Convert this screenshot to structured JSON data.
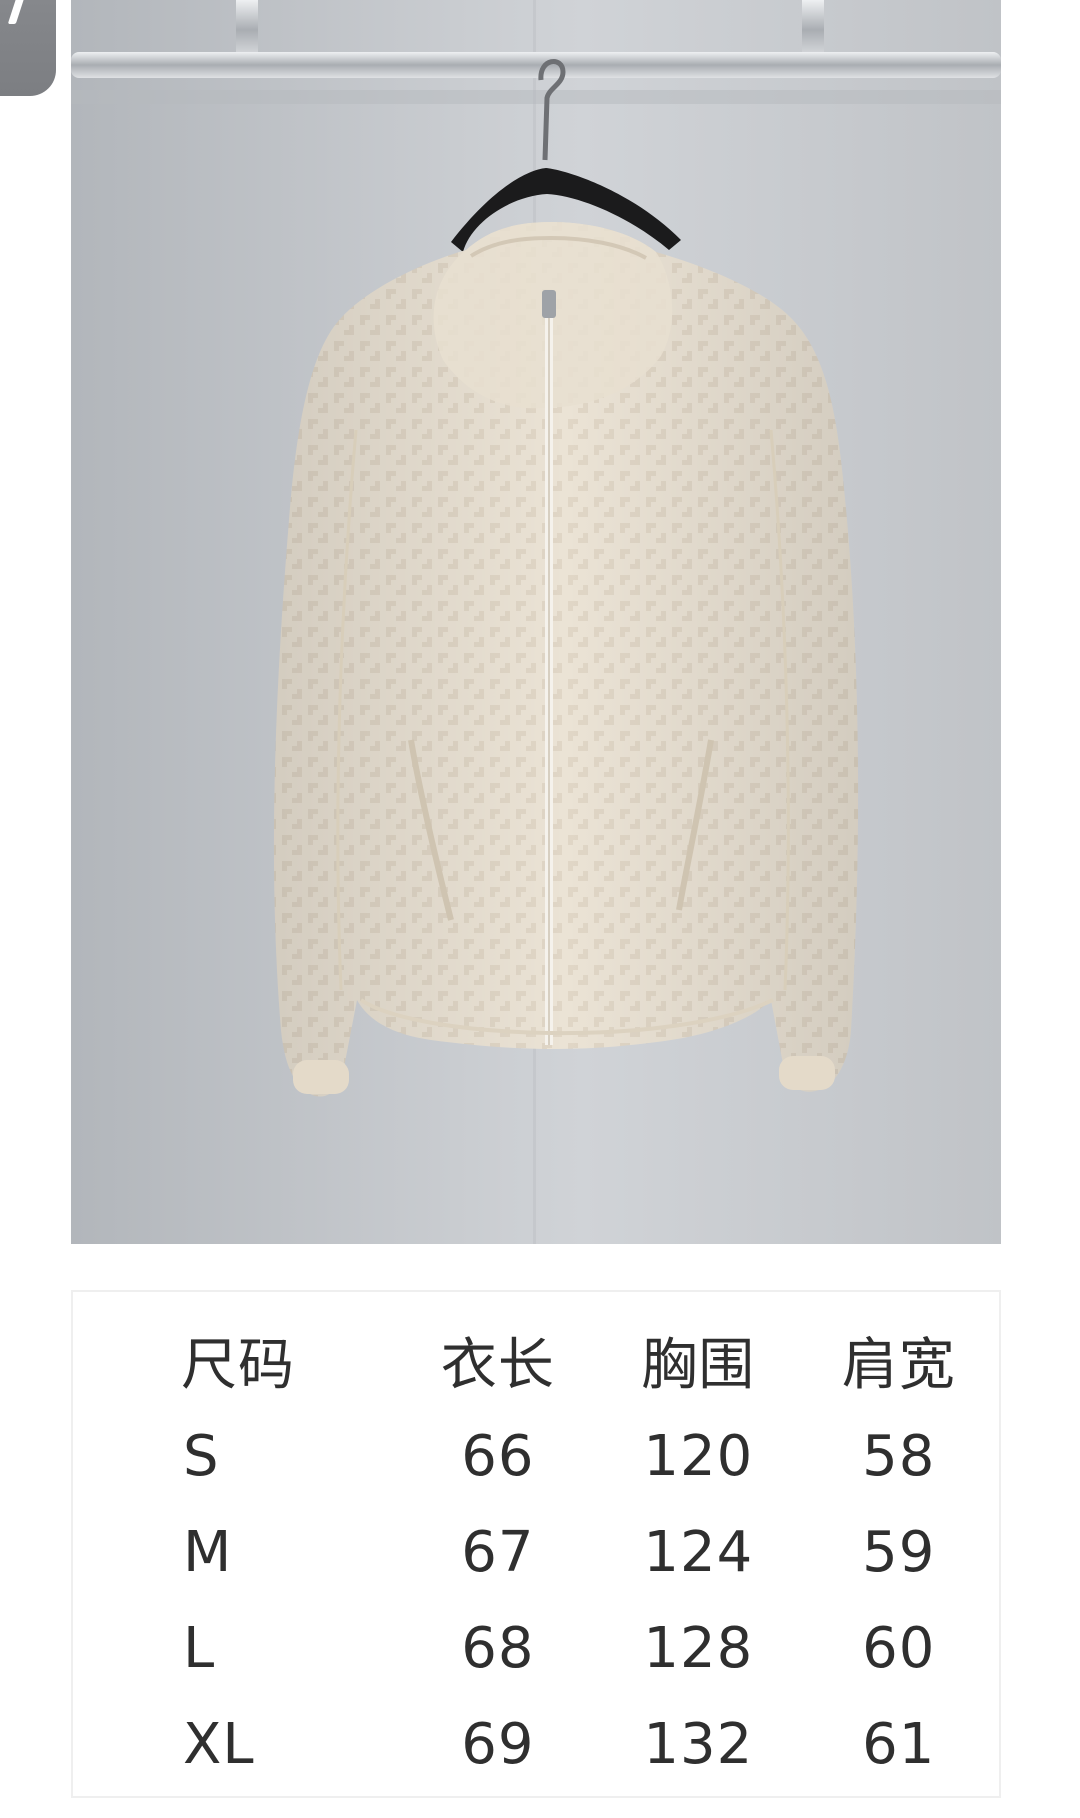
{
  "photo": {
    "subject": "hooded-zip-jacket-on-hanger",
    "jacket_color": "#ebe2d3",
    "wall_color": "#c8cbcf",
    "rail_color": "#b9bcc0",
    "hanger_color": "#1c1c1c"
  },
  "size_table": {
    "headers": [
      "尺码",
      "衣长",
      "胸围",
      "肩宽"
    ],
    "rows": [
      [
        "S",
        "66",
        "120",
        "58"
      ],
      [
        "M",
        "67",
        "124",
        "59"
      ],
      [
        "L",
        "68",
        "128",
        "60"
      ],
      [
        "XL",
        "69",
        "132",
        "61"
      ]
    ]
  }
}
